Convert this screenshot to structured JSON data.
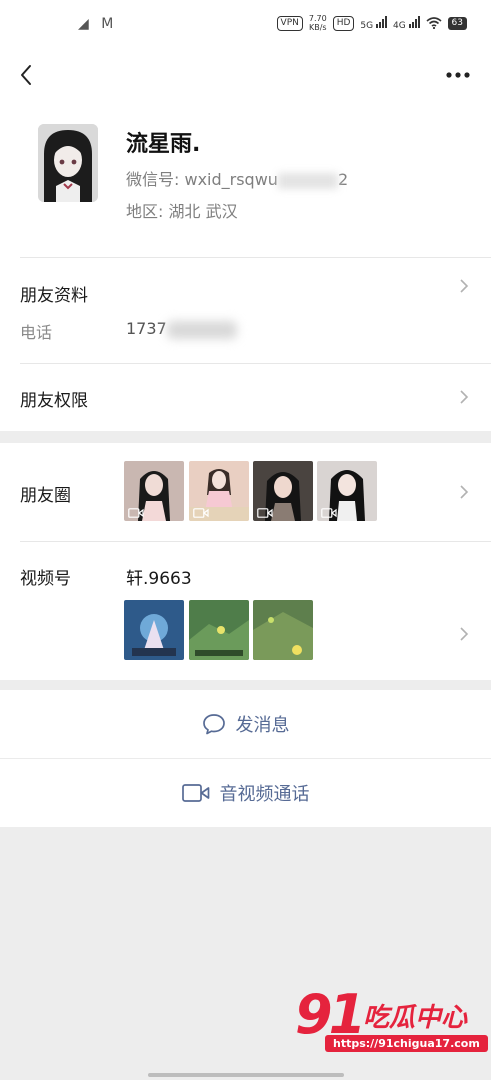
{
  "status_bar": {
    "left_icons": "◢ M",
    "vpn": "VPN",
    "speed_value": "7.70",
    "speed_unit": "KB/s",
    "hd": "HD",
    "net5g": "5G",
    "net4g": "4G",
    "battery": "63"
  },
  "nav": {
    "back_icon": "chevron-left",
    "more_icon": "ellipsis"
  },
  "profile": {
    "name": "流星雨.",
    "wechat_id": "微信号: wxid_rsqwu",
    "wechat_id_tail": "2",
    "region": "地区: 湖北  武汉"
  },
  "friend_info": {
    "label": "朋友资料",
    "phone_label": "电话",
    "phone_value": "1737"
  },
  "permissions": {
    "label": "朋友权限"
  },
  "moments": {
    "label": "朋友圈"
  },
  "channels": {
    "label": "视频号",
    "name": "轩.9663"
  },
  "actions": {
    "message": "发消息",
    "call": "音视频通话"
  },
  "watermark": {
    "number": "91",
    "text": "吃瓜中心",
    "url": "https://91chigua17.com"
  },
  "colors": {
    "link": "#576b95",
    "accent": "#e5233d"
  }
}
